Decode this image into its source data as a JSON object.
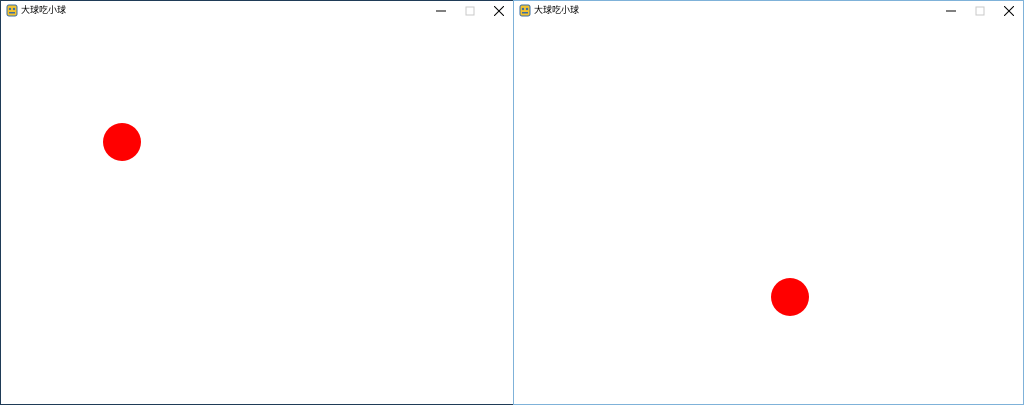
{
  "windows": [
    {
      "title": "大球吃小球",
      "icon": "pygame-snake-icon",
      "controls": [
        "minimize",
        "maximize",
        "close"
      ]
    },
    {
      "title": "大球吃小球",
      "icon": "pygame-snake-icon",
      "controls": [
        "minimize",
        "maximize",
        "close"
      ]
    }
  ],
  "colors": {
    "ball": "#ff0000",
    "canvas_background": "#ffffff",
    "left_window_border": "#1f3b57",
    "right_window_border": "#7fb2d9",
    "icon_yellow": "#f2c230",
    "icon_blue": "#3a6ea5"
  }
}
